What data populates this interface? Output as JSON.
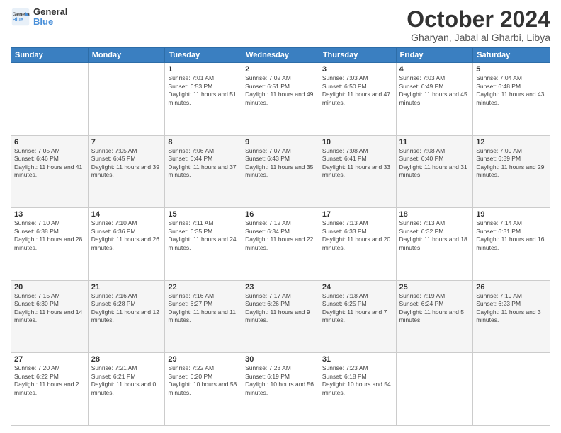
{
  "logo": {
    "line1": "General",
    "line2": "Blue"
  },
  "title": "October 2024",
  "subtitle": "Gharyan, Jabal al Gharbi, Libya",
  "days_header": [
    "Sunday",
    "Monday",
    "Tuesday",
    "Wednesday",
    "Thursday",
    "Friday",
    "Saturday"
  ],
  "weeks": [
    [
      {
        "day": "",
        "info": ""
      },
      {
        "day": "",
        "info": ""
      },
      {
        "day": "1",
        "info": "Sunrise: 7:01 AM\nSunset: 6:53 PM\nDaylight: 11 hours and 51 minutes."
      },
      {
        "day": "2",
        "info": "Sunrise: 7:02 AM\nSunset: 6:51 PM\nDaylight: 11 hours and 49 minutes."
      },
      {
        "day": "3",
        "info": "Sunrise: 7:03 AM\nSunset: 6:50 PM\nDaylight: 11 hours and 47 minutes."
      },
      {
        "day": "4",
        "info": "Sunrise: 7:03 AM\nSunset: 6:49 PM\nDaylight: 11 hours and 45 minutes."
      },
      {
        "day": "5",
        "info": "Sunrise: 7:04 AM\nSunset: 6:48 PM\nDaylight: 11 hours and 43 minutes."
      }
    ],
    [
      {
        "day": "6",
        "info": "Sunrise: 7:05 AM\nSunset: 6:46 PM\nDaylight: 11 hours and 41 minutes."
      },
      {
        "day": "7",
        "info": "Sunrise: 7:05 AM\nSunset: 6:45 PM\nDaylight: 11 hours and 39 minutes."
      },
      {
        "day": "8",
        "info": "Sunrise: 7:06 AM\nSunset: 6:44 PM\nDaylight: 11 hours and 37 minutes."
      },
      {
        "day": "9",
        "info": "Sunrise: 7:07 AM\nSunset: 6:43 PM\nDaylight: 11 hours and 35 minutes."
      },
      {
        "day": "10",
        "info": "Sunrise: 7:08 AM\nSunset: 6:41 PM\nDaylight: 11 hours and 33 minutes."
      },
      {
        "day": "11",
        "info": "Sunrise: 7:08 AM\nSunset: 6:40 PM\nDaylight: 11 hours and 31 minutes."
      },
      {
        "day": "12",
        "info": "Sunrise: 7:09 AM\nSunset: 6:39 PM\nDaylight: 11 hours and 29 minutes."
      }
    ],
    [
      {
        "day": "13",
        "info": "Sunrise: 7:10 AM\nSunset: 6:38 PM\nDaylight: 11 hours and 28 minutes."
      },
      {
        "day": "14",
        "info": "Sunrise: 7:10 AM\nSunset: 6:36 PM\nDaylight: 11 hours and 26 minutes."
      },
      {
        "day": "15",
        "info": "Sunrise: 7:11 AM\nSunset: 6:35 PM\nDaylight: 11 hours and 24 minutes."
      },
      {
        "day": "16",
        "info": "Sunrise: 7:12 AM\nSunset: 6:34 PM\nDaylight: 11 hours and 22 minutes."
      },
      {
        "day": "17",
        "info": "Sunrise: 7:13 AM\nSunset: 6:33 PM\nDaylight: 11 hours and 20 minutes."
      },
      {
        "day": "18",
        "info": "Sunrise: 7:13 AM\nSunset: 6:32 PM\nDaylight: 11 hours and 18 minutes."
      },
      {
        "day": "19",
        "info": "Sunrise: 7:14 AM\nSunset: 6:31 PM\nDaylight: 11 hours and 16 minutes."
      }
    ],
    [
      {
        "day": "20",
        "info": "Sunrise: 7:15 AM\nSunset: 6:30 PM\nDaylight: 11 hours and 14 minutes."
      },
      {
        "day": "21",
        "info": "Sunrise: 7:16 AM\nSunset: 6:28 PM\nDaylight: 11 hours and 12 minutes."
      },
      {
        "day": "22",
        "info": "Sunrise: 7:16 AM\nSunset: 6:27 PM\nDaylight: 11 hours and 11 minutes."
      },
      {
        "day": "23",
        "info": "Sunrise: 7:17 AM\nSunset: 6:26 PM\nDaylight: 11 hours and 9 minutes."
      },
      {
        "day": "24",
        "info": "Sunrise: 7:18 AM\nSunset: 6:25 PM\nDaylight: 11 hours and 7 minutes."
      },
      {
        "day": "25",
        "info": "Sunrise: 7:19 AM\nSunset: 6:24 PM\nDaylight: 11 hours and 5 minutes."
      },
      {
        "day": "26",
        "info": "Sunrise: 7:19 AM\nSunset: 6:23 PM\nDaylight: 11 hours and 3 minutes."
      }
    ],
    [
      {
        "day": "27",
        "info": "Sunrise: 7:20 AM\nSunset: 6:22 PM\nDaylight: 11 hours and 2 minutes."
      },
      {
        "day": "28",
        "info": "Sunrise: 7:21 AM\nSunset: 6:21 PM\nDaylight: 11 hours and 0 minutes."
      },
      {
        "day": "29",
        "info": "Sunrise: 7:22 AM\nSunset: 6:20 PM\nDaylight: 10 hours and 58 minutes."
      },
      {
        "day": "30",
        "info": "Sunrise: 7:23 AM\nSunset: 6:19 PM\nDaylight: 10 hours and 56 minutes."
      },
      {
        "day": "31",
        "info": "Sunrise: 7:23 AM\nSunset: 6:18 PM\nDaylight: 10 hours and 54 minutes."
      },
      {
        "day": "",
        "info": ""
      },
      {
        "day": "",
        "info": ""
      }
    ]
  ]
}
